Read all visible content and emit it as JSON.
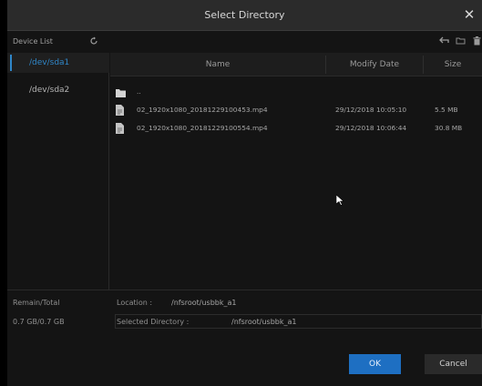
{
  "dialog": {
    "title": "Select Directory",
    "close_glyph": "✕"
  },
  "toolbar": {
    "device_list_label": "Device List",
    "icons": [
      "back-icon",
      "folder-icon",
      "trash-icon"
    ]
  },
  "devices": [
    {
      "label": "/dev/sda1",
      "selected": true
    },
    {
      "label": "/dev/sda2",
      "selected": false
    }
  ],
  "file_table": {
    "headers": {
      "name": "Name",
      "modify_date": "Modify Date",
      "size": "Size"
    },
    "rows": [
      {
        "type": "folder",
        "name": "..",
        "date": "",
        "size": ""
      },
      {
        "type": "file",
        "name": "02_1920x1080_20181229100453.mp4",
        "date": "29/12/2018 10:05:10",
        "size": "5.5 MB"
      },
      {
        "type": "file",
        "name": "02_1920x1080_20181229100554.mp4",
        "date": "29/12/2018 10:06:44",
        "size": "30.8 MB"
      }
    ]
  },
  "footer": {
    "remain_total_label": "Remain/Total",
    "remain_total_value": "0.7 GB/0.7 GB",
    "location_label": "Location :",
    "location_value": "/nfsroot/usbbk_a1",
    "selected_directory_label": "Selected Directory :",
    "selected_directory_value": "/nfsroot/usbbk_a1"
  },
  "buttons": {
    "ok": "OK",
    "cancel": "Cancel"
  },
  "colors": {
    "accent": "#2f86c8",
    "ok_button": "#1e6fc2",
    "background": "#141414",
    "titlebar": "#2b2b2b"
  }
}
